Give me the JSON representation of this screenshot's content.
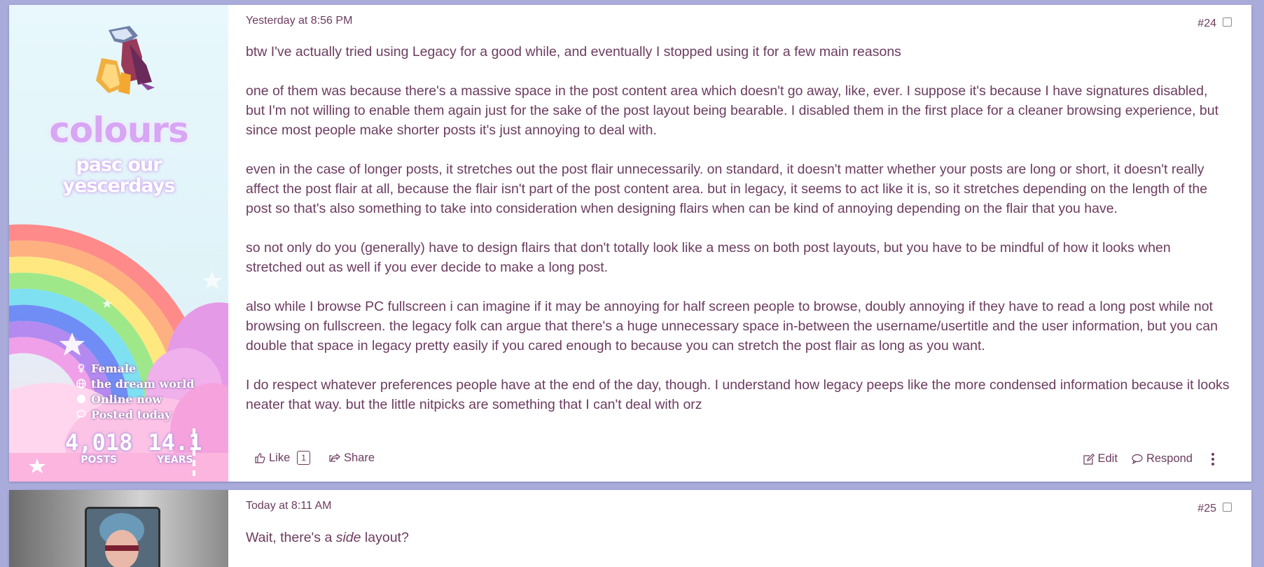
{
  "posts": [
    {
      "flair": {
        "title": "colours",
        "subtitle_line1": "pasc our",
        "subtitle_line2": "yescerdays",
        "info": [
          {
            "icon": "female-icon",
            "text": "Female"
          },
          {
            "icon": "globe-icon",
            "text": "the dream world"
          },
          {
            "icon": "online-icon",
            "text": "Online now"
          },
          {
            "icon": "speech-bubble-icon",
            "text": "Posted today"
          }
        ],
        "stats": [
          {
            "value": "4,018",
            "label": "POSTS"
          },
          {
            "value": "14.1",
            "label": "YEARS"
          }
        ]
      },
      "timestamp": "Yesterday at 8:56 PM",
      "number": "#24",
      "paragraphs": [
        "btw I've actually tried using Legacy for a good while, and eventually I stopped using it for a few main reasons",
        "one of them was because there's a massive space in the post content area which doesn't go away, like, ever. I suppose it's because I have signatures disabled, but I'm not willing to enable them again just for the sake of the post layout being bearable. I disabled them in the first place for a cleaner browsing experience, but since most people make shorter posts it's just annoying to deal with.",
        "even in the case of longer posts, it stretches out the post flair unnecessarily. on standard, it doesn't matter whether your posts are long or short, it doesn't really affect the post flair at all, because the flair isn't part of the post content area. but in legacy, it seems to act like it is, so it stretches depending on the length of the post so that's also something to take into consideration when designing flairs when can be kind of annoying depending on the flair that you have.",
        "so not only do you (generally) have to design flairs that don't totally look like a mess on both post layouts, but you have to be mindful of how it looks when stretched out as well if you ever decide to make a long post.",
        "also while I browse PC fullscreen i can imagine if it may be annoying for half screen people to browse, doubly annoying if they have to read a long post while not browsing on fullscreen. the legacy folk can argue that there's a huge unnecessary space in-between the username/usertitle and the user information, but you can double that space in legacy pretty easily if you cared enough to because you can stretch the post flair as long as you want.",
        "I do respect whatever preferences people have at the end of the day, though. I understand how legacy peeps like the more condensed information because it looks neater that way. but the little nitpicks are something that I can't deal with orz"
      ],
      "actions": {
        "like_label": "Like",
        "like_count": "1",
        "share_label": "Share",
        "edit_label": "Edit",
        "respond_label": "Respond"
      }
    },
    {
      "timestamp": "Today at 8:11 AM",
      "number": "#25",
      "body_before": "Wait, there's a ",
      "body_em": "side",
      "body_after": " layout?"
    }
  ],
  "colors": {
    "page_bg": "#a9acdb",
    "text": "#6c3c60",
    "flair_title": "#d7a6f4"
  }
}
